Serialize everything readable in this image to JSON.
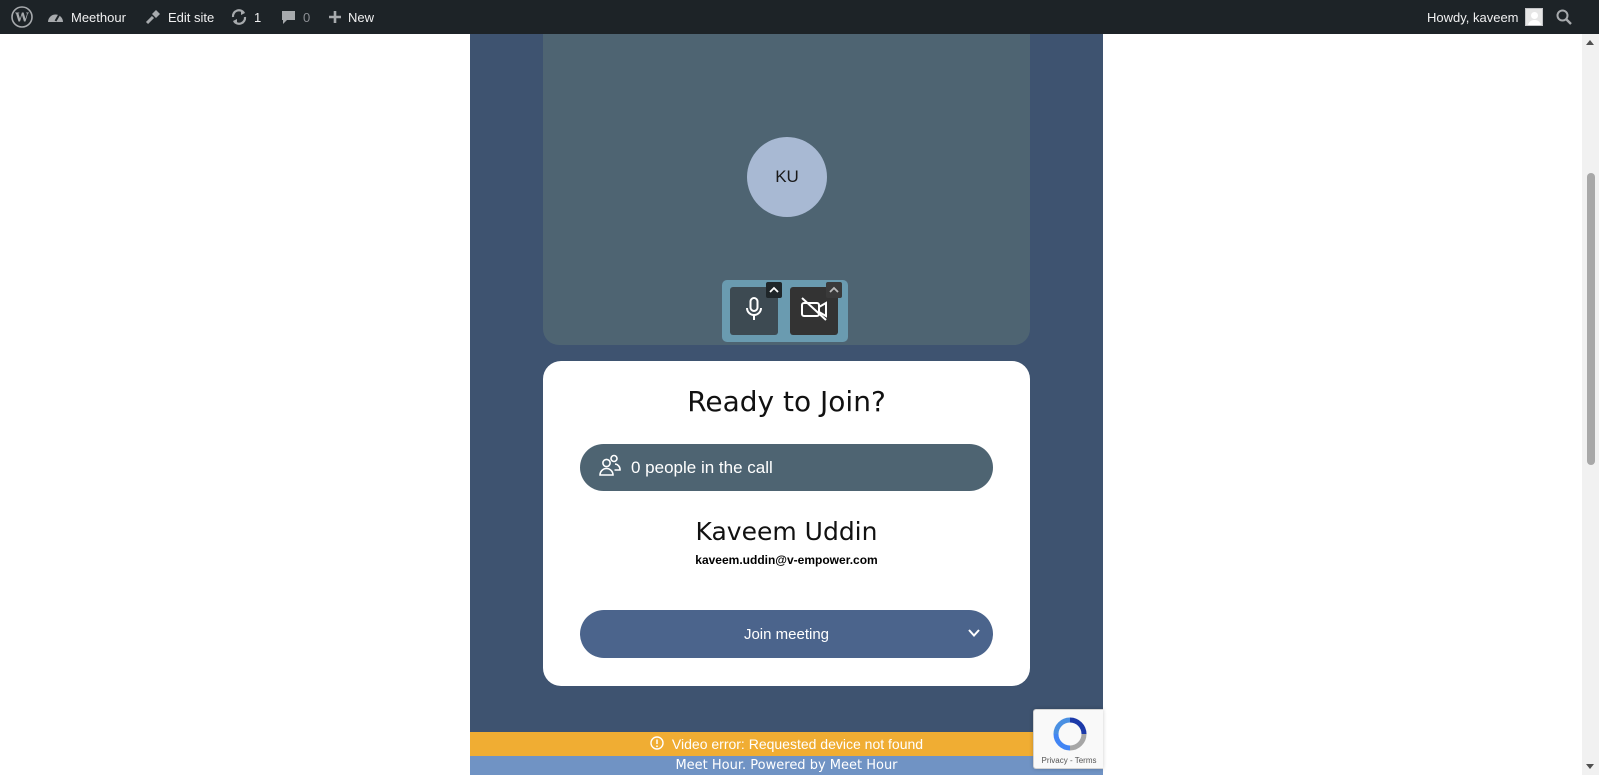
{
  "adminbar": {
    "site_name": "Meethour",
    "edit_site": "Edit site",
    "updates_count": "1",
    "comments_count": "0",
    "new_label": "New",
    "greeting": "Howdy, kaveem"
  },
  "preview": {
    "avatar_initials": "KU"
  },
  "join": {
    "title": "Ready to Join?",
    "people_in_call": "0 people in the call",
    "user_name": "Kaveem Uddin",
    "user_email": "kaveem.uddin@v-empower.com",
    "join_button": "Join meeting"
  },
  "notifications": {
    "video_error": "Video error: Requested device not found"
  },
  "footer": {
    "text": "Meet Hour. Powered by Meet Hour"
  },
  "recaptcha": {
    "links": "Privacy - Terms"
  },
  "colors": {
    "admin_bar": "#1d2327",
    "meeting_bg": "#3e5370",
    "preview_bg": "#4e6472",
    "join_button": "#4b648c",
    "error_bar": "#f0ad33",
    "footer_bar": "#7093c4"
  },
  "icons": [
    "wordpress-logo-icon",
    "dashboard-icon",
    "edit-site-icon",
    "updates-icon",
    "comments-icon",
    "plus-icon",
    "search-icon",
    "microphone-icon",
    "video-off-icon",
    "caret-up-icon",
    "people-icon",
    "chevron-down-icon",
    "alert-circle-icon",
    "recaptcha-logo-icon"
  ]
}
